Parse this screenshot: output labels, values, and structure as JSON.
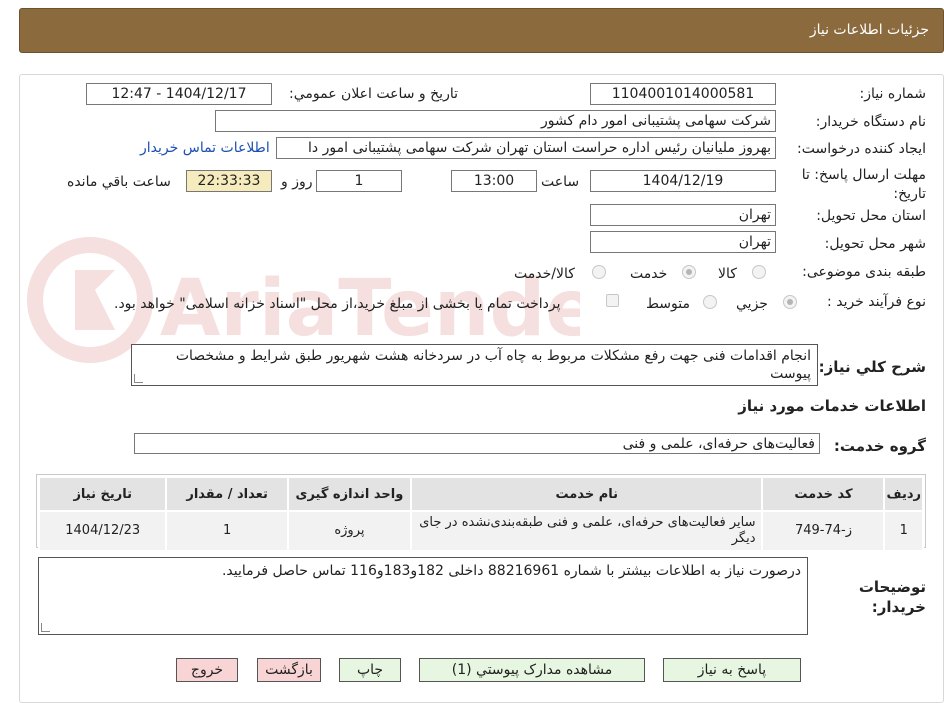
{
  "header": {
    "title": "جزئيات اطلاعات نياز"
  },
  "watermark_text": "AriaTender.neT",
  "labels": {
    "need_number": "شماره نياز:",
    "announce_datetime": "تاريخ و ساعت اعلان عمومي:",
    "buyer_org": "نام دستگاه خريدار:",
    "requester": "ايجاد کننده درخواست:",
    "deadline": "مهلت ارسال پاسخ: تا تاريخ:",
    "hour": "ساعت",
    "day_and": "روز و",
    "hours_remaining": "ساعت باقي مانده",
    "province": "استان محل تحويل:",
    "city": "شهر محل تحويل:",
    "category": "طبقه بندی موضوعی:",
    "purchase_type": "نوع فرآيند خريد :",
    "description": "شرح کلي نياز:",
    "services_info": "اطلاعات خدمات مورد نياز",
    "service_group": "گروه خدمت:",
    "buyer_notes": "توضيحات خريدار:"
  },
  "fields": {
    "need_number": "1104001014000581",
    "announce_datetime": "1404/12/17 - 12:47",
    "buyer_org": "شرکت سهامی پشتيبانی امور دام کشور",
    "requester": "بهروز مليانيان رئيس اداره حراست استان تهران شرکت سهامی پشتيبانی امور دا",
    "contact_link": "اطلاعات تماس خريدار",
    "deadline_date": "1404/12/19",
    "deadline_time": "13:00",
    "days": "1",
    "remaining_time": "22:33:33",
    "province": "تهران",
    "city": "تهران",
    "description": "انجام اقدامات فنی جهت رفع مشکلات مربوط به چاه آب در سردخانه هشت شهريور طبق شرايط و مشخصات پيوست",
    "service_group": "فعاليت‌های حرفه‌ای، علمی و فنی",
    "buyer_notes": "درصورت نياز به اطلاعات بيشتر با شماره 88216961 داخلی 182و183و116 تماس حاصل فرماييد."
  },
  "category_options": [
    {
      "label": "کالا",
      "checked": false
    },
    {
      "label": "خدمت",
      "checked": true
    },
    {
      "label": "کالا/خدمت",
      "checked": false
    }
  ],
  "purchase_options": [
    {
      "label": "جزيي",
      "checked": true
    },
    {
      "label": "متوسط",
      "checked": false
    }
  ],
  "payment_note": "پرداخت تمام يا بخشی از مبلغ خريد،از محل \"اسناد خزانه اسلامی\" خواهد بود.",
  "table": {
    "headers": [
      "رديف",
      "کد خدمت",
      "نام خدمت",
      "واحد اندازه گيری",
      "تعداد / مقدار",
      "تاريخ نياز"
    ],
    "rows": [
      [
        "1",
        "ز-74-749",
        "ساير فعاليت‌های حرفه‌ای، علمی و فنی طبقه‌بندی‌نشده در جای ديگر",
        "پروژه",
        "1",
        "1404/12/23"
      ]
    ]
  },
  "buttons": {
    "reply": "پاسخ به نياز",
    "view_docs": "مشاهده مدارک پيوستي (1)",
    "print": "چاپ",
    "back": "بازگشت",
    "exit": "خروج"
  }
}
